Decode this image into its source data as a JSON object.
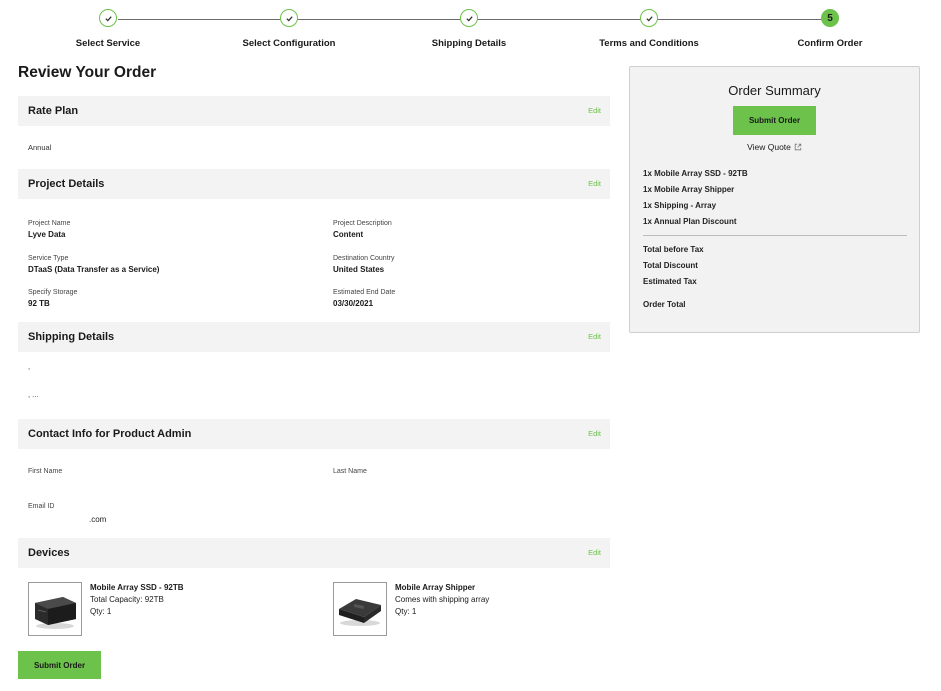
{
  "stepper": {
    "steps": [
      {
        "label": "Select Service",
        "state": "done"
      },
      {
        "label": "Select Configuration",
        "state": "done"
      },
      {
        "label": "Shipping Details",
        "state": "done"
      },
      {
        "label": "Terms and Conditions",
        "state": "done"
      },
      {
        "label": "Confirm Order",
        "state": "current",
        "number": "5"
      }
    ]
  },
  "page_title": "Review Your Order",
  "edit_label": "Edit",
  "rate_plan": {
    "title": "Rate Plan",
    "value": "Annual"
  },
  "project_details": {
    "title": "Project Details",
    "fields": {
      "project_name": {
        "label": "Project Name",
        "value": "Lyve Data"
      },
      "project_description": {
        "label": "Project Description",
        "value": "Content"
      },
      "service_type": {
        "label": "Service Type",
        "value": "DTaaS (Data Transfer as a Service)"
      },
      "destination_country": {
        "label": "Destination Country",
        "value": "United States"
      },
      "specify_storage": {
        "label": "Specify Storage",
        "value": "92 TB"
      },
      "estimated_end_date": {
        "label": "Estimated End Date",
        "value": "03/30/2021"
      }
    }
  },
  "shipping_details": {
    "title": "Shipping Details",
    "line1": ",",
    "line2": ", ..."
  },
  "contact_info": {
    "title": "Contact Info for Product Admin",
    "first_name_label": "First Name",
    "last_name_label": "Last Name",
    "email_label": "Email ID",
    "email_value": ".com"
  },
  "devices": {
    "title": "Devices",
    "items": [
      {
        "name": "Mobile Array SSD - 92TB",
        "detail": "Total Capacity: 92TB",
        "qty": "Qty: 1"
      },
      {
        "name": "Mobile Array Shipper",
        "detail": "Comes with shipping array",
        "qty": "Qty: 1"
      }
    ]
  },
  "submit_label": "Submit Order",
  "summary": {
    "title": "Order Summary",
    "submit_label": "Submit Order",
    "view_quote": "View Quote",
    "items": [
      "1x Mobile Array SSD - 92TB",
      "1x Mobile Array Shipper",
      "1x Shipping - Array",
      "1x Annual Plan Discount"
    ],
    "totals": [
      "Total before Tax",
      "Total Discount",
      "Estimated Tax"
    ],
    "order_total": "Order Total"
  },
  "colors": {
    "accent": "#6cc24a",
    "section_bg": "#f3f3f3",
    "summary_bg": "#f2f2f2"
  },
  "icons": {
    "step_done": "check-icon",
    "view_quote": "external-link-icon"
  }
}
